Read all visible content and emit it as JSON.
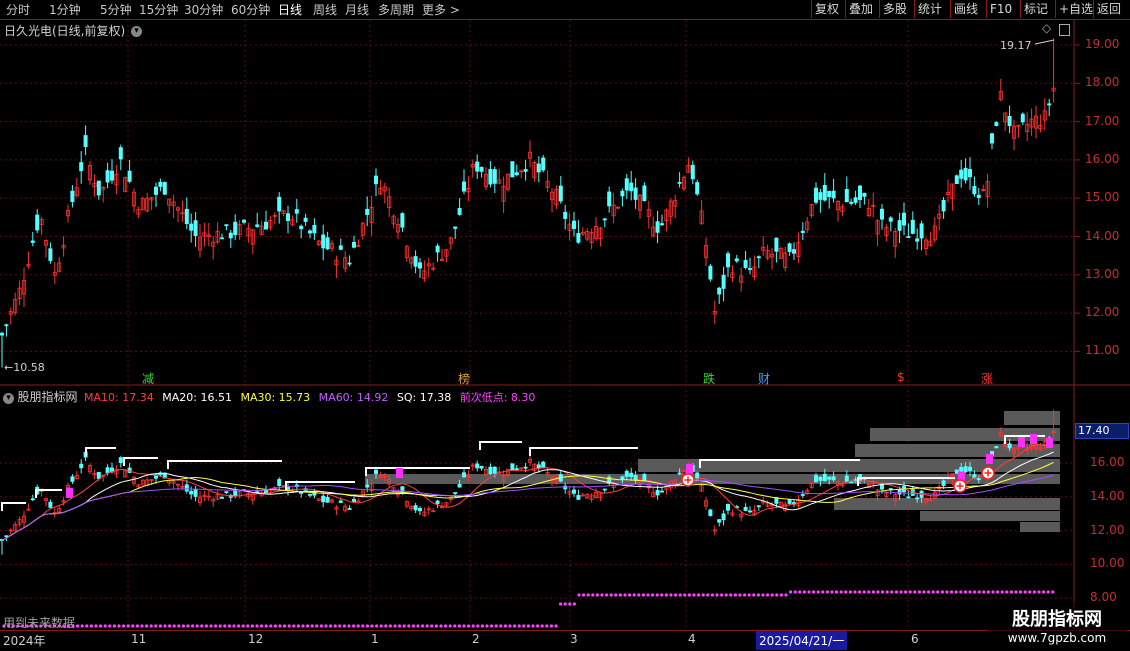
{
  "toolbar": {
    "periods": [
      "分时",
      "1分钟",
      "5分钟",
      "15分钟",
      "30分钟",
      "60分钟",
      "日线",
      "周线",
      "月线",
      "多周期",
      "更多 >"
    ],
    "active_period": "日线",
    "tools": [
      "复权",
      "叠加",
      "多股",
      "统计",
      "画线",
      "F10",
      "标记",
      "+自选",
      "返回"
    ]
  },
  "main_chart": {
    "title": "日久光电(日线,前复权)",
    "high_label": "19.17",
    "low_label": "10.58",
    "y_ticks": [
      "19.00",
      "18.00",
      "17.00",
      "16.00",
      "15.00",
      "14.00",
      "13.00",
      "12.00",
      "11.00"
    ],
    "markers": [
      {
        "text": "减",
        "color": "#3ad43a"
      },
      {
        "text": "榜",
        "color": "#e0a040"
      },
      {
        "text": "跌",
        "color": "#3ad43a"
      },
      {
        "text": "财",
        "color": "#40a0ff"
      },
      {
        "text": "$",
        "color": "#ff3030"
      },
      {
        "text": "涨",
        "color": "#ff3030"
      }
    ]
  },
  "indicator": {
    "name": "股朋指标网",
    "ma10": {
      "label": "MA10: 17.34",
      "color": "#ff4040"
    },
    "ma20": {
      "label": "MA20: 16.51",
      "color": "#ffffff"
    },
    "ma30": {
      "label": "MA30: 15.73",
      "color": "#ffff40"
    },
    "ma60": {
      "label": "MA60: 14.92",
      "color": "#c060ff"
    },
    "sq": {
      "label": "SQ: 17.38",
      "color": "#ffffff"
    },
    "next_low": {
      "label": "前次低点: 8.30",
      "color": "#ff40ff"
    },
    "current_value": "17.40",
    "y_ticks": [
      "16.00",
      "14.00",
      "12.00",
      "10.00",
      "8.00"
    ],
    "note": "用到未来数据"
  },
  "bottom_axis": {
    "labels": [
      "2024年",
      "11",
      "12",
      "1",
      "2",
      "3",
      "4",
      "2025/04/21/一",
      "6"
    ],
    "cursor_date": "2025/04/21/一"
  },
  "watermark": {
    "title": "股朋指标网",
    "url": "www.7gpzb.com"
  }
}
